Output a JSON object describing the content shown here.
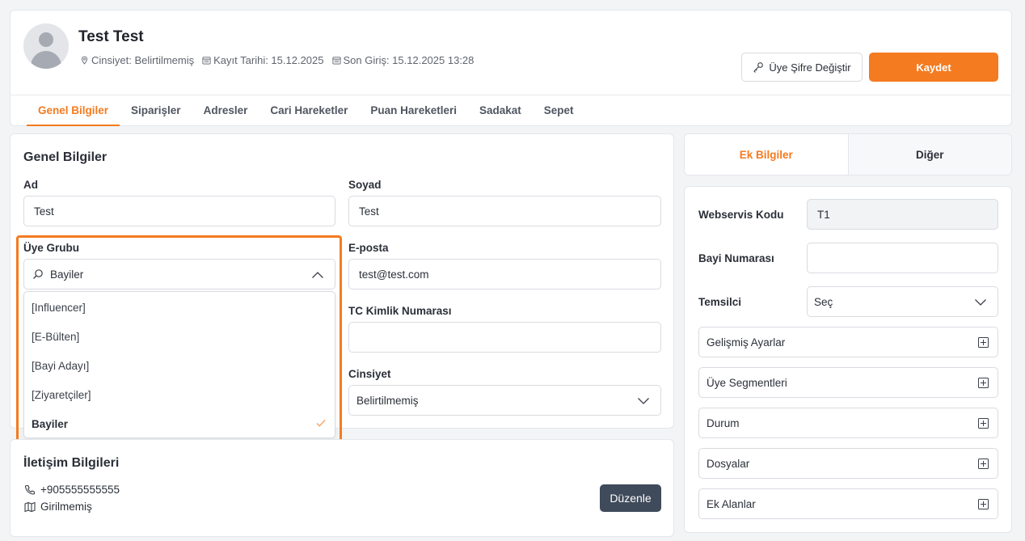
{
  "header": {
    "name": "Test Test",
    "gender_meta": "Cinsiyet: Belirtilmemiş",
    "register_meta": "Kayıt Tarihi: 15.12.2025",
    "last_login_meta": "Son Giriş: 15.12.2025 13:28",
    "change_password_label": "Üye Şifre Değiştir",
    "save_label": "Kaydet"
  },
  "tabs": [
    {
      "label": "Genel Bilgiler",
      "active": true
    },
    {
      "label": "Siparişler"
    },
    {
      "label": "Adresler"
    },
    {
      "label": "Cari Hareketler"
    },
    {
      "label": "Puan Hareketleri"
    },
    {
      "label": "Sadakat"
    },
    {
      "label": "Sepet"
    }
  ],
  "general": {
    "title": "Genel Bilgiler",
    "first_name_label": "Ad",
    "first_name_value": "Test",
    "last_name_label": "Soyad",
    "last_name_value": "Test",
    "group_label": "Üye Grubu",
    "group_value": "Bayiler",
    "email_label": "E-posta",
    "email_value": "test@test.com",
    "tc_label": "TC Kimlik Numarası",
    "tc_value": "",
    "gender_label": "Cinsiyet",
    "gender_value": "Belirtilmemiş",
    "group_options": [
      "[Influencer]",
      "[E-Bülten]",
      "[Bayi Adayı]",
      "[Ziyaretçiler]",
      "Bayiler"
    ]
  },
  "contact": {
    "title": "İletişim Bilgileri",
    "phone": "+905555555555",
    "address": "Girilmemiş",
    "edit_label": "Düzenle"
  },
  "right": {
    "tab_extra": "Ek Bilgiler",
    "tab_other": "Diğer",
    "webservice_label": "Webservis Kodu",
    "webservice_value": "T1",
    "dealer_label": "Bayi Numarası",
    "dealer_value": "",
    "rep_label": "Temsilci",
    "rep_value": "Seç",
    "sections": [
      "Gelişmiş Ayarlar",
      "Üye Segmentleri",
      "Durum",
      "Dosyalar",
      "Ek Alanlar"
    ]
  },
  "colors": {
    "accent": "#f47b20",
    "dark_button": "#3f4a5a"
  }
}
